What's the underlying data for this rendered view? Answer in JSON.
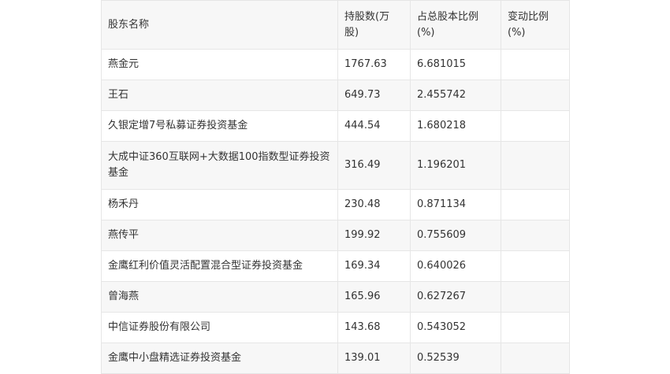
{
  "table": {
    "headers": [
      "股东名称",
      "持股数(万股)",
      "占总股本比例(%)",
      "变动比例(%)"
    ],
    "rows": [
      {
        "name": "燕金元",
        "shares": "1767.63",
        "ratio": "6.681015",
        "change": ""
      },
      {
        "name": "王石",
        "shares": "649.73",
        "ratio": "2.455742",
        "change": ""
      },
      {
        "name": "久银定增7号私募证券投资基金",
        "shares": "444.54",
        "ratio": "1.680218",
        "change": ""
      },
      {
        "name": "大成中证360互联网+大数据100指数型证券投资基金",
        "shares": "316.49",
        "ratio": "1.196201",
        "change": ""
      },
      {
        "name": "杨禾丹",
        "shares": "230.48",
        "ratio": "0.871134",
        "change": ""
      },
      {
        "name": "燕传平",
        "shares": "199.92",
        "ratio": "0.755609",
        "change": ""
      },
      {
        "name": "金鹰红利价值灵活配置混合型证券投资基金",
        "shares": "169.34",
        "ratio": "0.640026",
        "change": ""
      },
      {
        "name": "曾海燕",
        "shares": "165.96",
        "ratio": "0.627267",
        "change": ""
      },
      {
        "name": "中信证券股份有限公司",
        "shares": "143.68",
        "ratio": "0.543052",
        "change": ""
      },
      {
        "name": "金鹰中小盘精选证券投资基金",
        "shares": "139.01",
        "ratio": "0.52539",
        "change": ""
      }
    ]
  }
}
